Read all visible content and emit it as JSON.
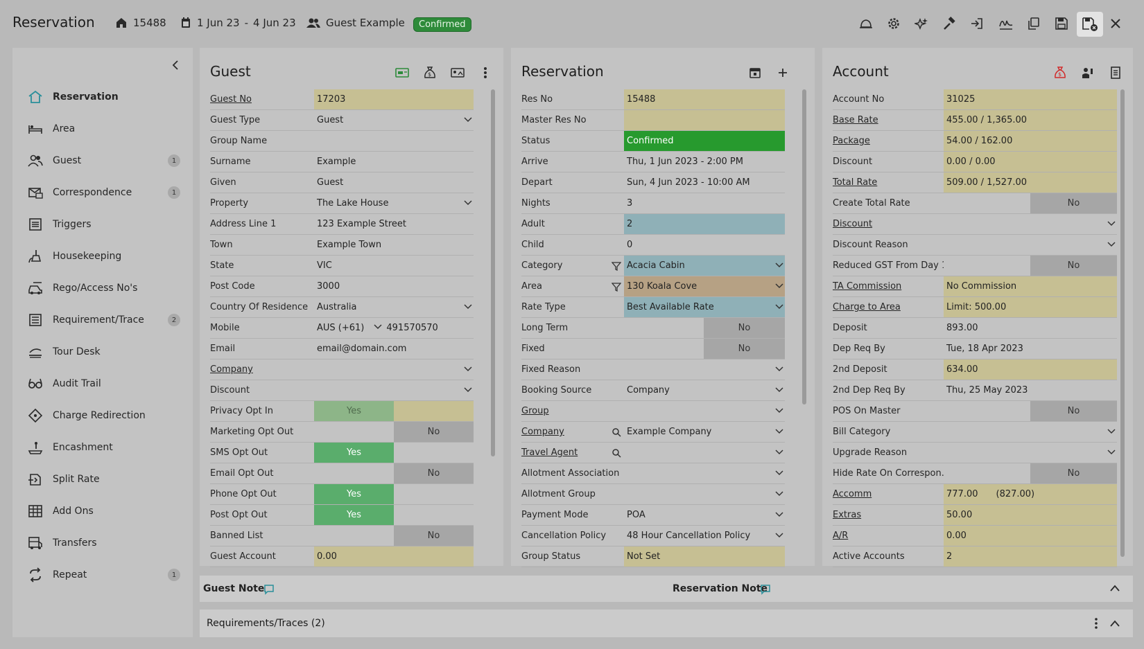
{
  "header": {
    "title": "Reservation",
    "res_number": "15488",
    "date_from": "1 Jun 23",
    "date_sep": "-",
    "date_to": "4 Jun 23",
    "guest_name": "Guest Example",
    "status": "Confirmed"
  },
  "toolbar_icons": [
    "bell-icon",
    "gear-icon",
    "stars-icon",
    "hammer-icon",
    "sign-in-icon",
    "signature-icon",
    "copy-icon",
    "save-icon",
    "save-close-icon",
    "close-icon"
  ],
  "sidebar": {
    "items": [
      {
        "label": "Reservation",
        "icon": "home-icon",
        "count": ""
      },
      {
        "label": "Area",
        "icon": "bed-icon",
        "count": ""
      },
      {
        "label": "Guest",
        "icon": "users-icon",
        "count": "1"
      },
      {
        "label": "Correspondence",
        "icon": "mail-icon",
        "count": "1"
      },
      {
        "label": "Triggers",
        "icon": "list-icon",
        "count": ""
      },
      {
        "label": "Housekeeping",
        "icon": "broom-icon",
        "count": ""
      },
      {
        "label": "Rego/Access No's",
        "icon": "car-icon",
        "count": ""
      },
      {
        "label": "Requirement/Trace",
        "icon": "checklist-icon",
        "count": "2"
      },
      {
        "label": "Tour Desk",
        "icon": "tour-icon",
        "count": ""
      },
      {
        "label": "Audit Trail",
        "icon": "glasses-icon",
        "count": ""
      },
      {
        "label": "Charge Redirection",
        "icon": "redirect-icon",
        "count": ""
      },
      {
        "label": "Encashment",
        "icon": "encash-icon",
        "count": ""
      },
      {
        "label": "Split Rate",
        "icon": "split-icon",
        "count": ""
      },
      {
        "label": "Add Ons",
        "icon": "grid-icon",
        "count": ""
      },
      {
        "label": "Transfers",
        "icon": "bus-icon",
        "count": ""
      },
      {
        "label": "Repeat",
        "icon": "repeat-icon",
        "count": "1"
      }
    ]
  },
  "guest": {
    "title": "Guest",
    "rows": [
      {
        "label": "Guest No",
        "value": "17203"
      },
      {
        "label": "Guest Type",
        "value": "Guest"
      },
      {
        "label": "Group Name",
        "value": ""
      },
      {
        "label": "Surname",
        "value": "Example"
      },
      {
        "label": "Given",
        "value": "Guest"
      },
      {
        "label": "Property",
        "value": "The Lake House"
      },
      {
        "label": "Address Line 1",
        "value": "123 Example Street"
      },
      {
        "label": "Town",
        "value": "Example Town"
      },
      {
        "label": "State",
        "value": "VIC"
      },
      {
        "label": "Post Code",
        "value": "3000"
      },
      {
        "label": "Country Of Residence",
        "value": "Australia"
      },
      {
        "label": "Mobile",
        "value": "AUS (+61)",
        "value2": "491570570"
      },
      {
        "label": "Email",
        "value": "email@domain.com"
      },
      {
        "label": "Company",
        "value": ""
      },
      {
        "label": "Discount",
        "value": ""
      },
      {
        "label": "Privacy Opt In",
        "value": "Yes"
      },
      {
        "label": "Marketing Opt Out",
        "value": "No"
      },
      {
        "label": "SMS Opt Out",
        "value": "Yes"
      },
      {
        "label": "Email Opt Out",
        "value": "No"
      },
      {
        "label": "Phone Opt Out",
        "value": "Yes"
      },
      {
        "label": "Post Opt Out",
        "value": "Yes"
      },
      {
        "label": "Banned List",
        "value": "No"
      },
      {
        "label": "Guest Account",
        "value": "0.00"
      }
    ]
  },
  "reservation": {
    "title": "Reservation",
    "rows": [
      {
        "label": "Res No",
        "value": "15488"
      },
      {
        "label": "Master Res No",
        "value": ""
      },
      {
        "label": "Status",
        "value": "Confirmed"
      },
      {
        "label": "Arrive",
        "value": "Thu, 1 Jun 2023 - 2:00 PM"
      },
      {
        "label": "Depart",
        "value": "Sun, 4 Jun 2023 - 10:00 AM"
      },
      {
        "label": "Nights",
        "value": "3"
      },
      {
        "label": "Adult",
        "value": "2"
      },
      {
        "label": "Child",
        "value": "0"
      },
      {
        "label": "Category",
        "value": "Acacia Cabin"
      },
      {
        "label": "Area",
        "value": "130 Koala Cove"
      },
      {
        "label": "Rate Type",
        "value": "Best Available Rate"
      },
      {
        "label": "Long Term",
        "value": "No"
      },
      {
        "label": "Fixed",
        "value": "No"
      },
      {
        "label": "Fixed Reason",
        "value": ""
      },
      {
        "label": "Booking Source",
        "value": "Company"
      },
      {
        "label": "Group",
        "value": ""
      },
      {
        "label": "Company",
        "value": "Example Company"
      },
      {
        "label": "Travel Agent",
        "value": ""
      },
      {
        "label": "Allotment Association",
        "value": ""
      },
      {
        "label": "Allotment Group",
        "value": ""
      },
      {
        "label": "Payment Mode",
        "value": "POA"
      },
      {
        "label": "Cancellation Policy",
        "value": "48 Hour Cancellation Policy"
      },
      {
        "label": "Group Status",
        "value": "Not Set"
      }
    ]
  },
  "account": {
    "title": "Account",
    "rows": [
      {
        "label": "Account No",
        "value": "31025"
      },
      {
        "label": "Base Rate",
        "value": "455.00 / 1,365.00"
      },
      {
        "label": "Package",
        "value": "54.00 / 162.00"
      },
      {
        "label": "Discount",
        "value": "0.00 / 0.00"
      },
      {
        "label": "Total Rate",
        "value": "509.00 / 1,527.00"
      },
      {
        "label": "Create Total Rate",
        "value": "No"
      },
      {
        "label": "Discount",
        "value": ""
      },
      {
        "label": "Discount Reason",
        "value": ""
      },
      {
        "label": "Reduced GST From Day 1",
        "value": "No"
      },
      {
        "label": "TA Commission",
        "value": "No Commission"
      },
      {
        "label": "Charge to Area",
        "value": "Limit: 500.00"
      },
      {
        "label": "Deposit",
        "value": "893.00"
      },
      {
        "label": "Dep Req By",
        "value": "Tue, 18 Apr 2023"
      },
      {
        "label": "2nd Deposit",
        "value": "634.00"
      },
      {
        "label": "2nd Dep Req By",
        "value": "Thu, 25 May 2023"
      },
      {
        "label": "POS On Master",
        "value": "No"
      },
      {
        "label": "Bill Category",
        "value": ""
      },
      {
        "label": "Upgrade Reason",
        "value": ""
      },
      {
        "label": "Hide Rate On Correspon...",
        "value": "No"
      },
      {
        "label": "Accomm",
        "value": "777.00",
        "value2": "(827.00)"
      },
      {
        "label": "Extras",
        "value": "50.00"
      },
      {
        "label": "A/R",
        "value": "0.00"
      },
      {
        "label": "Active Accounts",
        "value": "2"
      }
    ]
  },
  "notes": {
    "guest_note": "Guest Note",
    "reservation_note": "Reservation Note"
  },
  "requirements": {
    "title": "Requirements/Traces (2)"
  }
}
